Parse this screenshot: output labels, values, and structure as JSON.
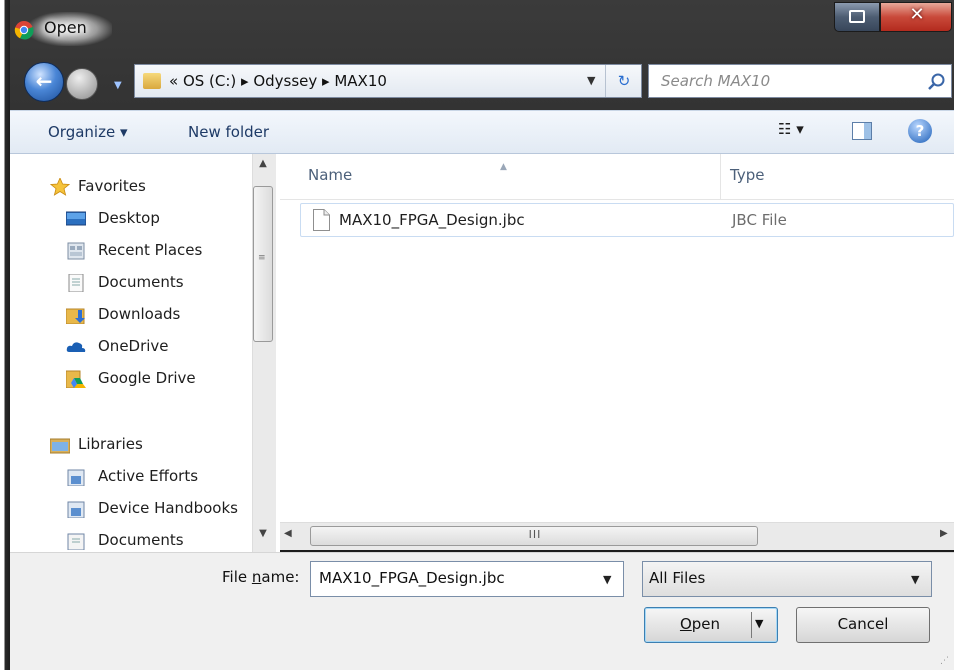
{
  "window": {
    "title": "Open",
    "close_glyph": "✕"
  },
  "address_bar": {
    "path_text": "« OS (C:) ▸ Odyssey ▸ MAX10",
    "refresh_glyph": "↻"
  },
  "search": {
    "placeholder": "Search MAX10"
  },
  "toolbar": {
    "organize_label": "Organize ▾",
    "new_folder_label": "New folder",
    "views_glyph": "☷ ▾",
    "help_glyph": "?"
  },
  "nav_pane": {
    "items": [
      {
        "label": "Favorites",
        "icon": "star-icon"
      },
      {
        "label": "Desktop",
        "icon": "desktop-icon"
      },
      {
        "label": "Recent Places",
        "icon": "recent-places-icon"
      },
      {
        "label": "Documents",
        "icon": "documents-icon"
      },
      {
        "label": "Downloads",
        "icon": "downloads-icon"
      },
      {
        "label": "OneDrive",
        "icon": "cloud-icon"
      },
      {
        "label": "Google Drive",
        "icon": "google-drive-icon"
      },
      {
        "label": "Libraries",
        "icon": "libraries-icon"
      },
      {
        "label": "Active Efforts",
        "icon": "library-icon"
      },
      {
        "label": "Device Handbooks",
        "icon": "library-icon"
      },
      {
        "label": "Documents",
        "icon": "library-documents-icon"
      }
    ]
  },
  "file_list": {
    "columns": {
      "name": "Name",
      "type": "Type"
    },
    "files": [
      {
        "name": "MAX10_FPGA_Design.jbc",
        "type": "JBC File"
      }
    ],
    "scroll_grip": "III"
  },
  "bottom": {
    "file_name_label": "File name:",
    "file_name_value": "MAX10_FPGA_Design.jbc",
    "filter_value": "All Files",
    "open_label": "Open",
    "cancel_label": "Cancel"
  }
}
